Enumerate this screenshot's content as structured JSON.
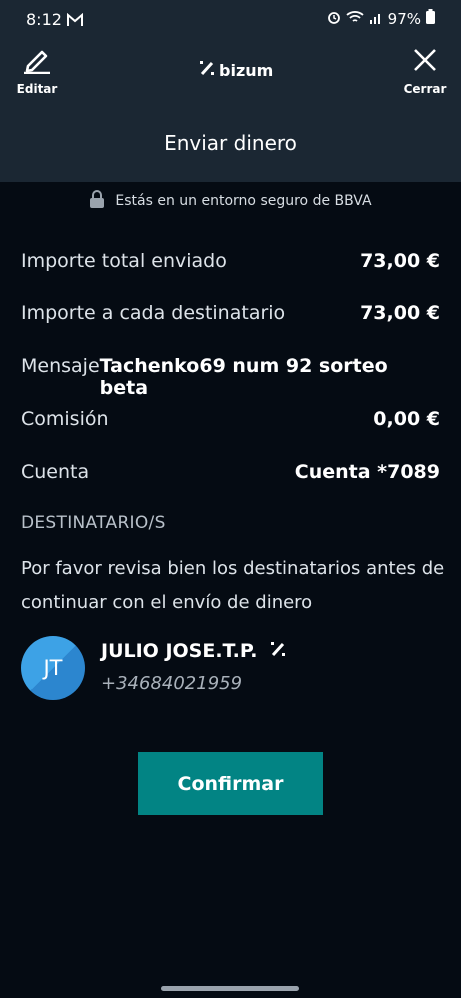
{
  "status": {
    "time": "8:12",
    "battery": "97%"
  },
  "header": {
    "edit_label": "Editar",
    "close_label": "Cerrar",
    "brand": "bizum",
    "title": "Enviar dinero"
  },
  "secure_notice": "Estás en un entorno seguro de BBVA",
  "details": [
    {
      "label": "Importe total enviado",
      "value": "73,00 €"
    },
    {
      "label": "Importe a cada destinatario",
      "value": "73,00 €"
    },
    {
      "label": "Mensaje",
      "value": "Tachenko69 num 92 sorteo beta"
    },
    {
      "label": "Comisión",
      "value": "0,00 €"
    },
    {
      "label": "Cuenta",
      "value": "Cuenta *7089"
    }
  ],
  "recipients": {
    "heading": "DESTINATARIO/S",
    "notice": "Por favor revisa bien los destinatarios antes de continuar con el envío de dinero",
    "items": [
      {
        "initials": "JT",
        "name": "JULIO JOSE.T.P.",
        "phone": "+34684021959"
      }
    ]
  },
  "confirm_label": "Confirmar",
  "colors": {
    "background": "#050b13",
    "header": "#1b2733",
    "accent": "#028484",
    "avatar": "#3da2e6"
  },
  "icons": [
    "gmail-icon",
    "wifi-icon",
    "signal-icon",
    "battery-icon",
    "pencil-icon",
    "close-icon",
    "bizum-logo-icon",
    "lock-icon"
  ]
}
